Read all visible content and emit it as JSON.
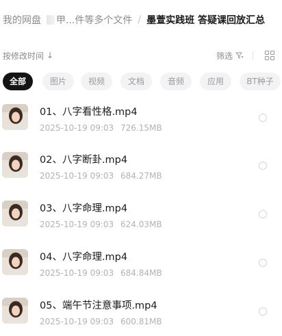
{
  "breadcrumb": {
    "root": "我的网盘",
    "middle": "甲...件等多个文件",
    "separator": "/",
    "current": "墨萱实践班 答疑课回放汇总"
  },
  "sortbar": {
    "sort_label": "按修改时间",
    "sort_arrow": "↓",
    "filter_label": "筛选",
    "filter_icon": "funnel-icon",
    "view_icon": "grid-view-icon"
  },
  "tabs": [
    {
      "label": "全部",
      "active": true
    },
    {
      "label": "图片",
      "active": false
    },
    {
      "label": "视频",
      "active": false
    },
    {
      "label": "文档",
      "active": false
    },
    {
      "label": "音频",
      "active": false
    },
    {
      "label": "应用",
      "active": false
    },
    {
      "label": "BT种子",
      "active": false
    }
  ],
  "files": [
    {
      "name": "01、八字看性格.mp4",
      "date": "2025-10-19",
      "time": "09:03",
      "size": "726.15MB"
    },
    {
      "name": "02、八字断卦.mp4",
      "date": "2025-10-19",
      "time": "09:03",
      "size": "684.27MB"
    },
    {
      "name": "03、八字命理.mp4",
      "date": "2025-10-19",
      "time": "09:03",
      "size": "624.03MB"
    },
    {
      "name": "04、八字命理.mp4",
      "date": "2025-10-19",
      "time": "09:03",
      "size": "684.84MB"
    },
    {
      "name": "05、端午节注意事项.mp4",
      "date": "2025-10-19",
      "time": "09:03",
      "size": "600.81MB"
    }
  ],
  "colors": {
    "active_tab": "#141414",
    "tab_bg": "#f3f3f5",
    "meta_text": "#b2b2b2"
  }
}
